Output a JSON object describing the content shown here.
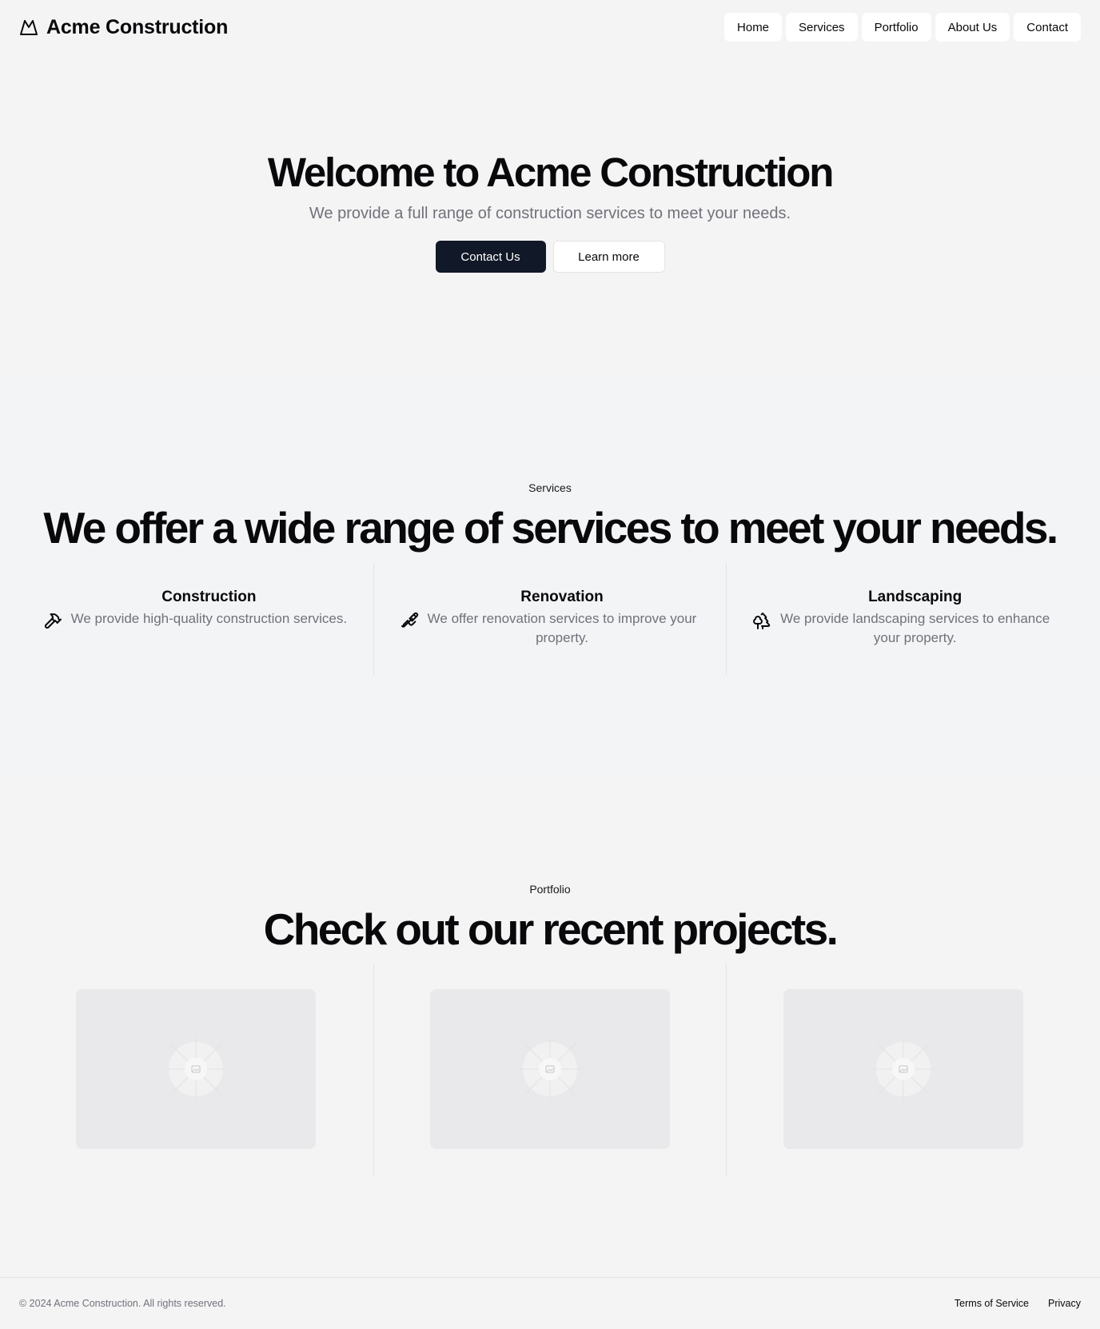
{
  "header": {
    "brand_name": "Acme Construction",
    "brand_icon": "mountain-icon",
    "nav": [
      {
        "label": "Home"
      },
      {
        "label": "Services"
      },
      {
        "label": "Portfolio"
      },
      {
        "label": "About Us"
      },
      {
        "label": "Contact"
      }
    ]
  },
  "hero": {
    "title": "Welcome to Acme Construction",
    "subtitle": "We provide a full range of construction services to meet your needs.",
    "primary_button": "Contact Us",
    "secondary_button": "Learn more"
  },
  "services": {
    "eyebrow": "Services",
    "title": "We offer a wide range of services to meet your needs.",
    "items": [
      {
        "name": "Construction",
        "description": "We provide high-quality construction services.",
        "icon": "hammer-icon"
      },
      {
        "name": "Renovation",
        "description": "We offer renovation services to improve your property.",
        "icon": "paintbrush-icon"
      },
      {
        "name": "Landscaping",
        "description": "We provide landscaping services to enhance your property.",
        "icon": "trees-icon"
      }
    ]
  },
  "portfolio": {
    "eyebrow": "Portfolio",
    "title": "Check out our recent projects.",
    "projects": [
      {
        "thumbnail": "image-placeholder-icon"
      },
      {
        "thumbnail": "image-placeholder-icon"
      },
      {
        "thumbnail": "image-placeholder-icon"
      }
    ]
  },
  "footer": {
    "copyright": "© 2024 Acme Construction. All rights reserved.",
    "links": [
      {
        "label": "Terms of Service"
      },
      {
        "label": "Privacy"
      }
    ]
  },
  "colors": {
    "background": "#f4f4f5",
    "primary_button": "#111827",
    "muted_text": "#71717a"
  }
}
